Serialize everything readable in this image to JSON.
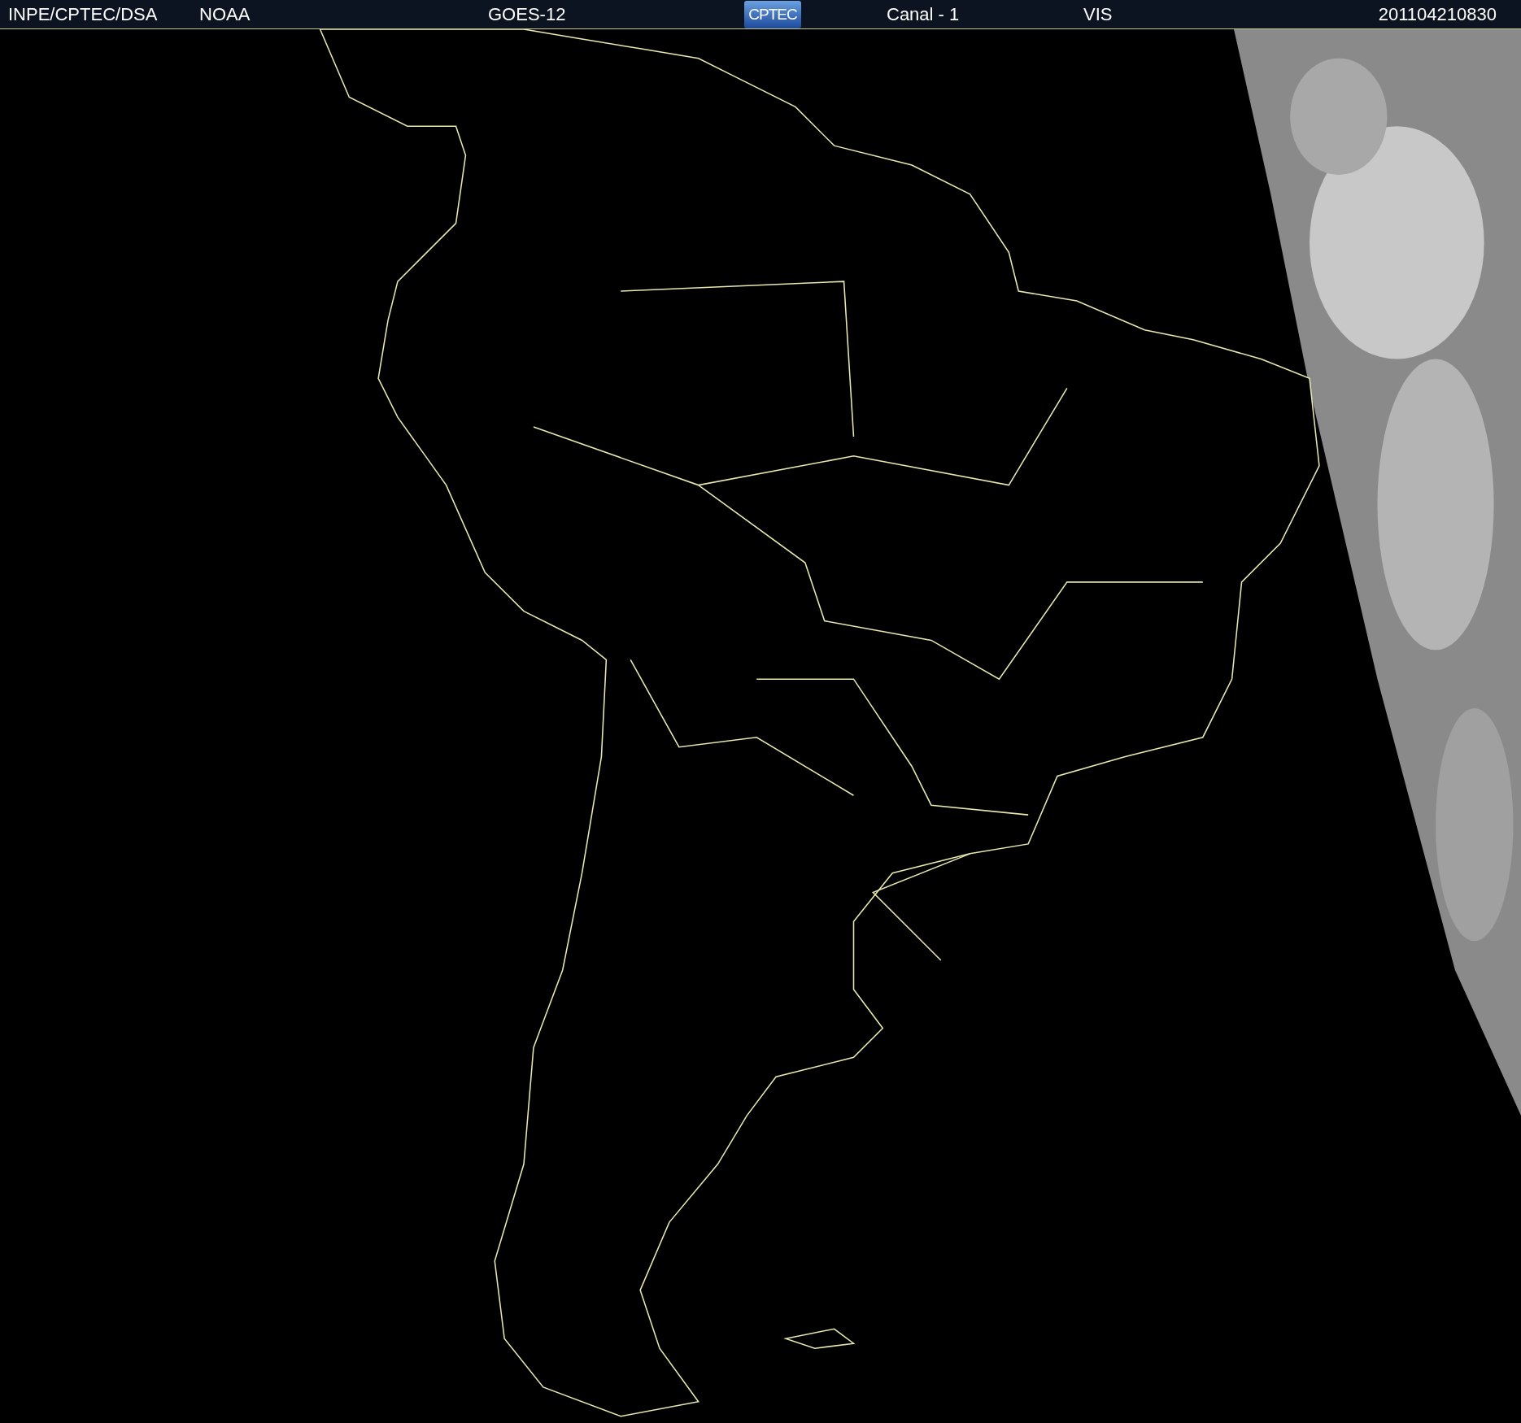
{
  "header": {
    "source": "INPE/CPTEC/DSA",
    "agency": "NOAA",
    "satellite": "GOES-12",
    "logo": "CPTEC",
    "channel": "Canal - 1",
    "band": "VIS",
    "timestamp": "201104210830"
  }
}
